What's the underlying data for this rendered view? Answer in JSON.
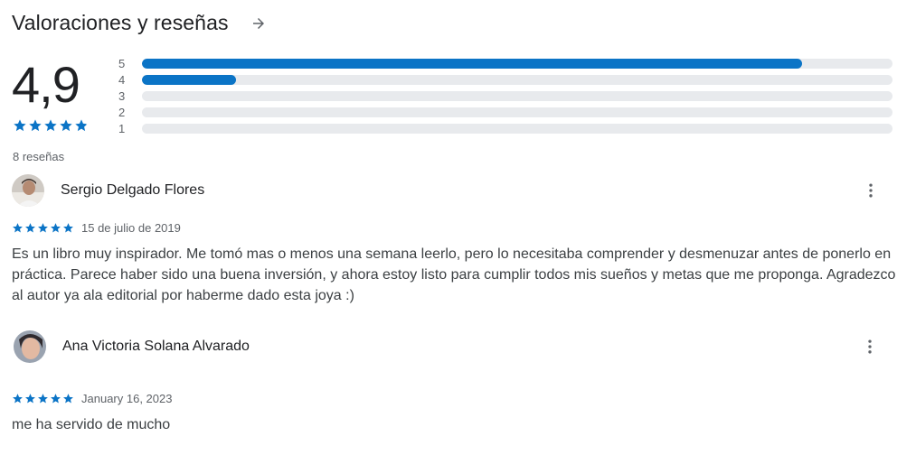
{
  "header": {
    "title": "Valoraciones y reseñas",
    "icon": "arrow-right-icon"
  },
  "summary": {
    "rating": "4,9",
    "rating_value": 4.9,
    "count_text": "8 reseñas",
    "accent_color": "#0b74c6",
    "distribution": [
      {
        "label": "5",
        "fraction": 0.88
      },
      {
        "label": "4",
        "fraction": 0.125
      },
      {
        "label": "3",
        "fraction": 0
      },
      {
        "label": "2",
        "fraction": 0
      },
      {
        "label": "1",
        "fraction": 0
      }
    ]
  },
  "reviews": [
    {
      "name": "Sergio Delgado Flores",
      "stars": 5,
      "date": "15 de julio de 2019",
      "text": "Es un libro muy inspirador. Me tomó mas o menos una semana leerlo, pero lo necesitaba comprender y desmenuzar antes de ponerlo en práctica. Parece haber sido una buena inversión, y ahora estoy listo para cumplir todos mis sueños y metas que me proponga. Agradezco al autor ya ala editorial por haberme dado esta joya :)"
    },
    {
      "name": "Ana Victoria Solana Alvarado",
      "stars": 5,
      "date": "January 16, 2023",
      "text": "me ha servido de mucho"
    }
  ]
}
